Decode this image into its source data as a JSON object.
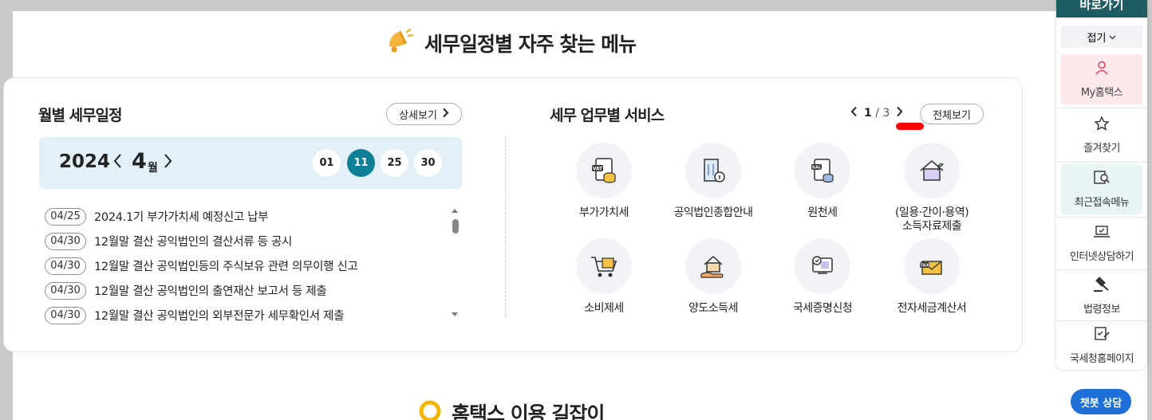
{
  "section_title": "세무일정별 자주 찾는 메뉴",
  "calendar": {
    "title": "월별 세무일정",
    "detail_label": "상세보기",
    "year": "2024",
    "month": "4",
    "month_unit": "월",
    "days": [
      "01",
      "11",
      "25",
      "30"
    ],
    "active_day": "11",
    "schedule": [
      {
        "date": "04/25",
        "text": "2024.1기 부가가치세 예정신고 납부"
      },
      {
        "date": "04/30",
        "text": "12월말 결산 공익법인의 결산서류 등 공시"
      },
      {
        "date": "04/30",
        "text": "12월말 결산 공익법인등의 주식보유 관련 의무이행 신고"
      },
      {
        "date": "04/30",
        "text": "12월말 결산 공익법인의 출연재산 보고서 등 제출"
      },
      {
        "date": "04/30",
        "text": "12월말 결산 공익법인의 외부전문가 세무확인서 제출"
      }
    ]
  },
  "services": {
    "title": "세무 업무별 서비스",
    "page_current": "1",
    "page_sep": "/",
    "page_total": "3",
    "view_all_label": "전체보기",
    "items": [
      {
        "label": "부가가치세",
        "icon": "vat-document-icon"
      },
      {
        "label": "공익법인종합안내",
        "icon": "building-info-icon"
      },
      {
        "label": "원천세",
        "icon": "withholding-tax-icon"
      },
      {
        "label": "(일용·간이·용역)\n소득자료제출",
        "icon": "house-plant-icon"
      },
      {
        "label": "소비제세",
        "icon": "shopping-cart-icon"
      },
      {
        "label": "양도소득세",
        "icon": "house-hand-icon"
      },
      {
        "label": "국세증명신청",
        "icon": "certificate-icon"
      },
      {
        "label": "전자세금계산서",
        "icon": "tax-envelope-icon"
      }
    ]
  },
  "bottom_title": "홈택스 이용 길잡이",
  "quick_panel": {
    "title": "바로가기",
    "fold_label": "접기",
    "items": [
      {
        "label": "My홈택스",
        "icon": "person-icon"
      },
      {
        "label": "즐겨찾기",
        "icon": "star-icon"
      },
      {
        "label": "최근접속메뉴",
        "icon": "recent-search-icon"
      },
      {
        "label": "인터넷상담하기",
        "icon": "laptop-chat-icon"
      },
      {
        "label": "법령정보",
        "icon": "gavel-icon"
      },
      {
        "label": "국세청홈페이지",
        "icon": "checklist-icon"
      }
    ]
  },
  "chatbot_label": "챗봇 상담",
  "colors": {
    "accent_teal": "#0e7f95",
    "month_bar_bg": "#e3f0f7",
    "quick_panel_head": "#1d5d63",
    "my_hometax_bg": "#fde8ec",
    "recent_bg": "#e8f4f5",
    "chatbot_blue": "#1e6fd8",
    "highlight_red": "#ff0000"
  }
}
